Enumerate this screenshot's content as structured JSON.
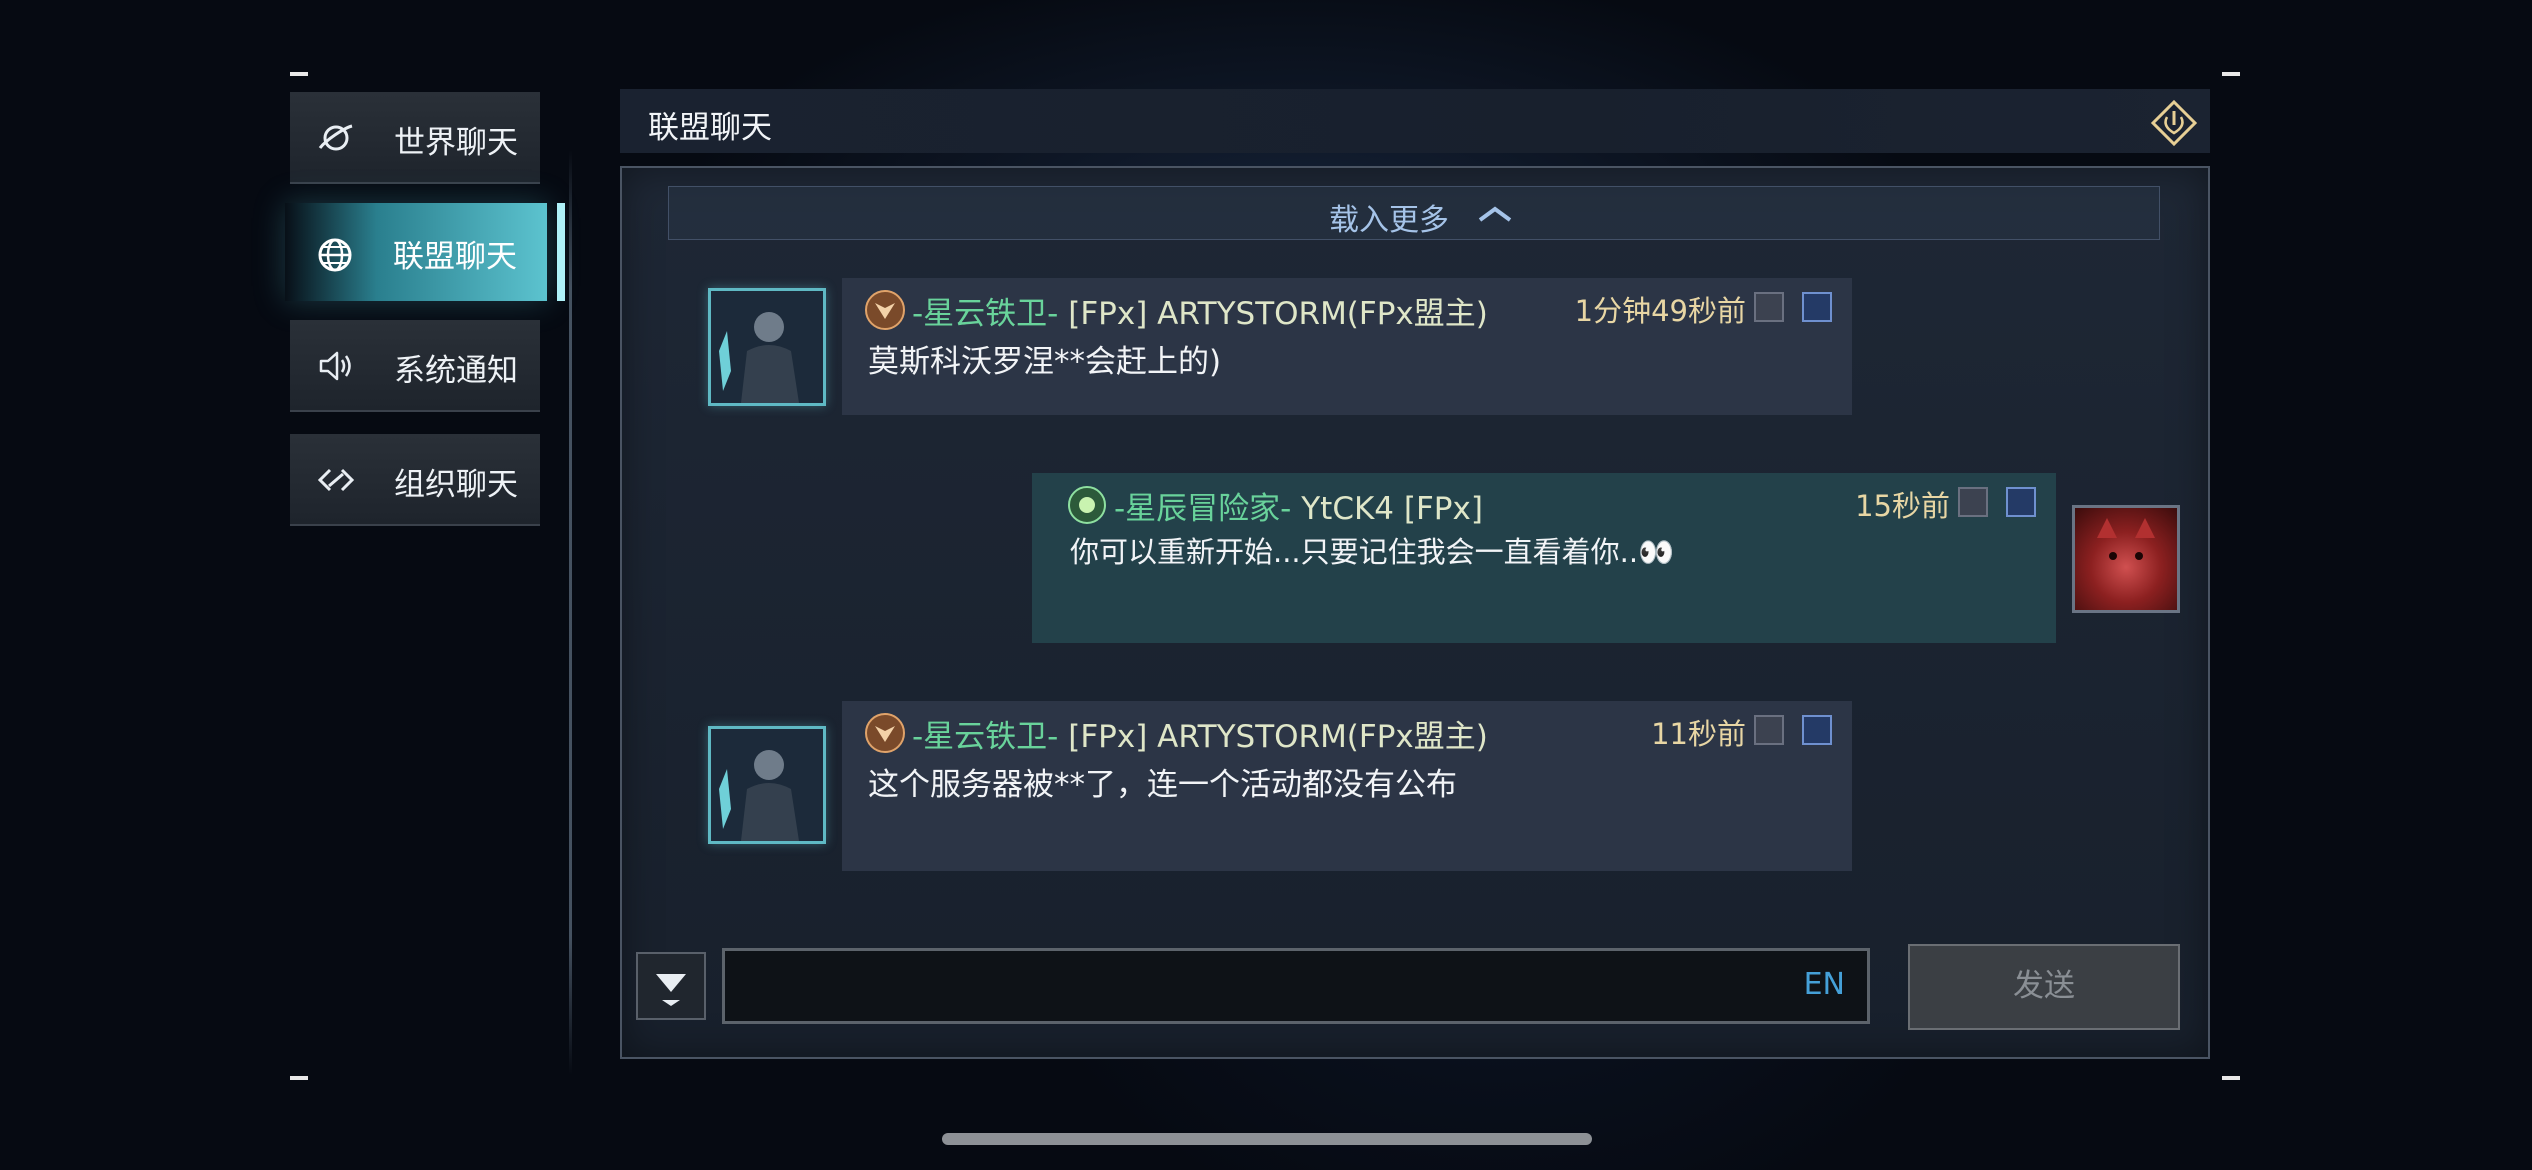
{
  "sidebar": {
    "tabs": [
      {
        "label": "世界聊天",
        "icon": "planet-icon"
      },
      {
        "label": "联盟聊天",
        "icon": "globe-icon",
        "active": true
      },
      {
        "label": "系统通知",
        "icon": "speaker-icon"
      },
      {
        "label": "组织聊天",
        "icon": "link-icon"
      }
    ]
  },
  "header": {
    "title": "联盟聊天",
    "exit_icon": "exit-icon"
  },
  "chat": {
    "load_more": "载入更多",
    "messages": [
      {
        "title": "-星云铁卫-",
        "name": "[FPx] ARTYSTORM(FPx盟主)",
        "time": "1分钟49秒前",
        "text": "莫斯科沃罗涅**会赶上的)",
        "side": "left"
      },
      {
        "title": "-星辰冒险家-",
        "name": "YtCK4 [FPx]",
        "time": "15秒前",
        "text": "你可以重新开始...只要记住我会一直看着你..👀",
        "side": "right"
      },
      {
        "title": "-星云铁卫-",
        "name": "[FPx] ARTYSTORM(FPx盟主)",
        "time": "11秒前",
        "text": "这个服务器被**了，连一个活动都没有公布",
        "side": "left"
      }
    ]
  },
  "input": {
    "value": "",
    "lang": "EN"
  },
  "send_label": "发送",
  "colors": {
    "accent": "#5cc3cf",
    "title_green": "#69d39b",
    "time": "#e8d6a4",
    "lang": "#45a0d8"
  }
}
